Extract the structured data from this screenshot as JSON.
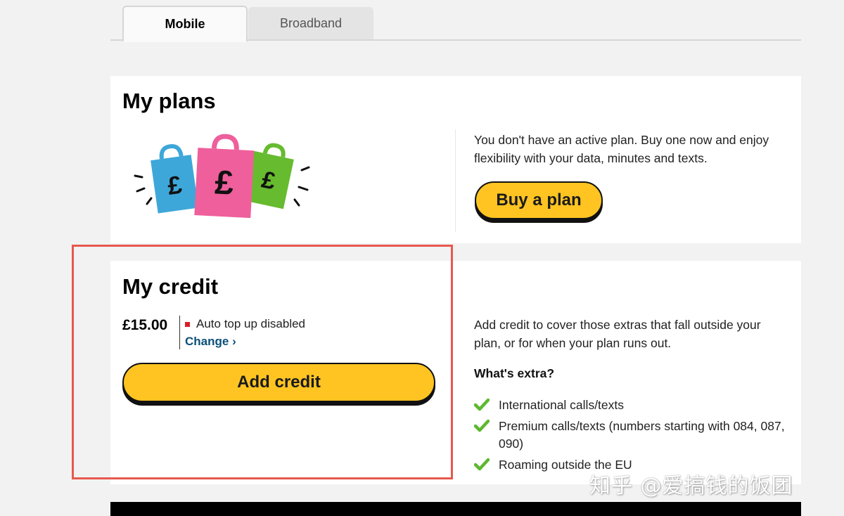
{
  "tabs": [
    {
      "label": "Mobile",
      "active": true
    },
    {
      "label": "Broadband",
      "active": false
    }
  ],
  "plans": {
    "title": "My plans",
    "description": "You don't have an active plan. Buy one now and enjoy flexibility with your data, minutes and texts.",
    "buy_button": "Buy a plan",
    "bag_symbol": "£"
  },
  "credit": {
    "title": "My credit",
    "balance": "£15.00",
    "auto_top_up": "Auto top up disabled",
    "change_link": "Change",
    "change_chevron": "›",
    "add_button": "Add credit",
    "description": "Add credit to cover those extras that fall outside your plan, or for when your plan runs out.",
    "extras_heading": "What's extra?",
    "extras": [
      "International calls/texts",
      "Premium calls/texts (numbers starting with 084, 087, 090)",
      "Roaming outside the EU"
    ]
  },
  "colors": {
    "accent_yellow": "#ffc422",
    "link_blue": "#0b4f7a",
    "check_green": "#5cb82e",
    "status_red": "#d8202a",
    "highlight_red": "#e8584d",
    "bag_blue": "#3ea7d9",
    "bag_pink": "#ee5f9c",
    "bag_green": "#66bb2f"
  },
  "icons": {
    "check": "check-icon",
    "chevron": "chevron-right-icon",
    "bags": "shopping-bags-illustration"
  },
  "watermark": "知乎 @爱搞钱的饭团"
}
